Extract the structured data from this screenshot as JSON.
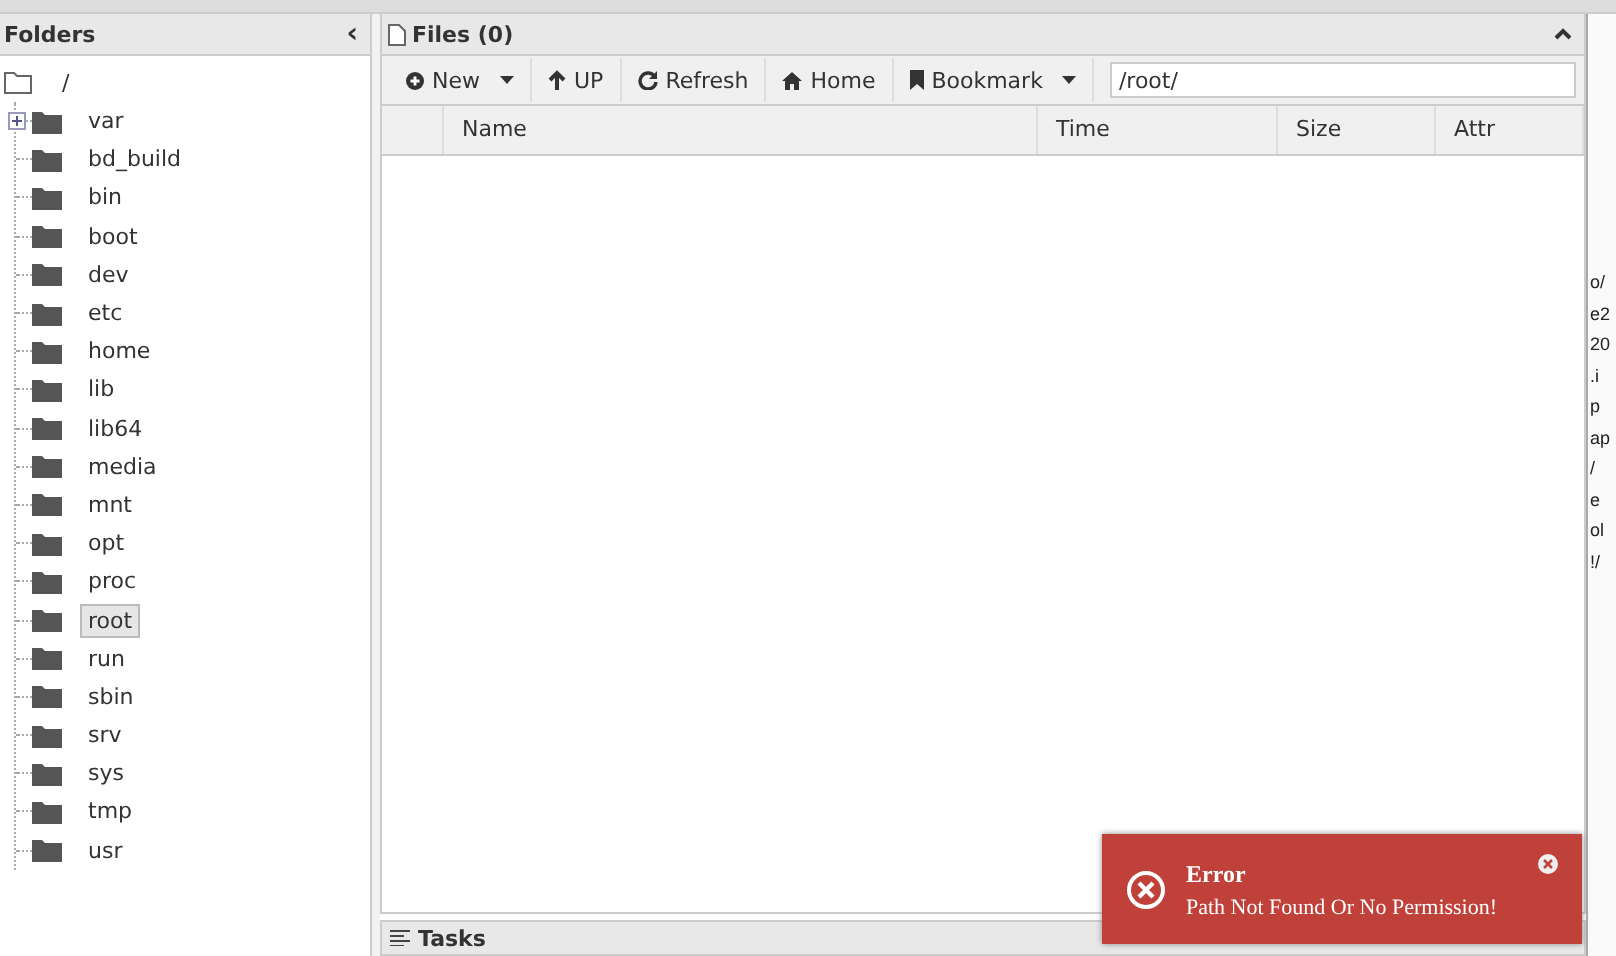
{
  "folders_panel": {
    "title": "Folders",
    "collapse_glyph": "‹",
    "tree": {
      "label": "/",
      "children": [
        {
          "label": "var",
          "has_children": true,
          "selected": false
        },
        {
          "label": "bd_build",
          "has_children": false,
          "selected": false
        },
        {
          "label": "bin",
          "has_children": false,
          "selected": false
        },
        {
          "label": "boot",
          "has_children": false,
          "selected": false
        },
        {
          "label": "dev",
          "has_children": false,
          "selected": false
        },
        {
          "label": "etc",
          "has_children": false,
          "selected": false
        },
        {
          "label": "home",
          "has_children": false,
          "selected": false
        },
        {
          "label": "lib",
          "has_children": false,
          "selected": false
        },
        {
          "label": "lib64",
          "has_children": false,
          "selected": false
        },
        {
          "label": "media",
          "has_children": false,
          "selected": false
        },
        {
          "label": "mnt",
          "has_children": false,
          "selected": false
        },
        {
          "label": "opt",
          "has_children": false,
          "selected": false
        },
        {
          "label": "proc",
          "has_children": false,
          "selected": false
        },
        {
          "label": "root",
          "has_children": false,
          "selected": true
        },
        {
          "label": "run",
          "has_children": false,
          "selected": false
        },
        {
          "label": "sbin",
          "has_children": false,
          "selected": false
        },
        {
          "label": "srv",
          "has_children": false,
          "selected": false
        },
        {
          "label": "sys",
          "has_children": false,
          "selected": false
        },
        {
          "label": "tmp",
          "has_children": false,
          "selected": false
        },
        {
          "label": "usr",
          "has_children": false,
          "selected": false
        }
      ]
    }
  },
  "files_panel": {
    "title": "Files (0)",
    "toolbar": [
      {
        "label": "New",
        "dropdown": true
      },
      {
        "label": "UP",
        "dropdown": false
      },
      {
        "label": "Refresh",
        "dropdown": false
      },
      {
        "label": "Home",
        "dropdown": false
      },
      {
        "label": "Bookmark",
        "dropdown": true
      }
    ],
    "path_field": {
      "value": "/root/"
    },
    "table": {
      "columns": [
        "Name",
        "Time",
        "Size",
        "Attr"
      ]
    }
  },
  "tasks_bar": {
    "title": "Tasks"
  },
  "background_fragments": [
    "o/",
    "e2",
    "20",
    ".i",
    "p",
    "ap",
    "/",
    "e",
    "ol",
    "!/"
  ],
  "toast": {
    "title": "Error",
    "message": "Path Not Found Or No Permission!"
  }
}
